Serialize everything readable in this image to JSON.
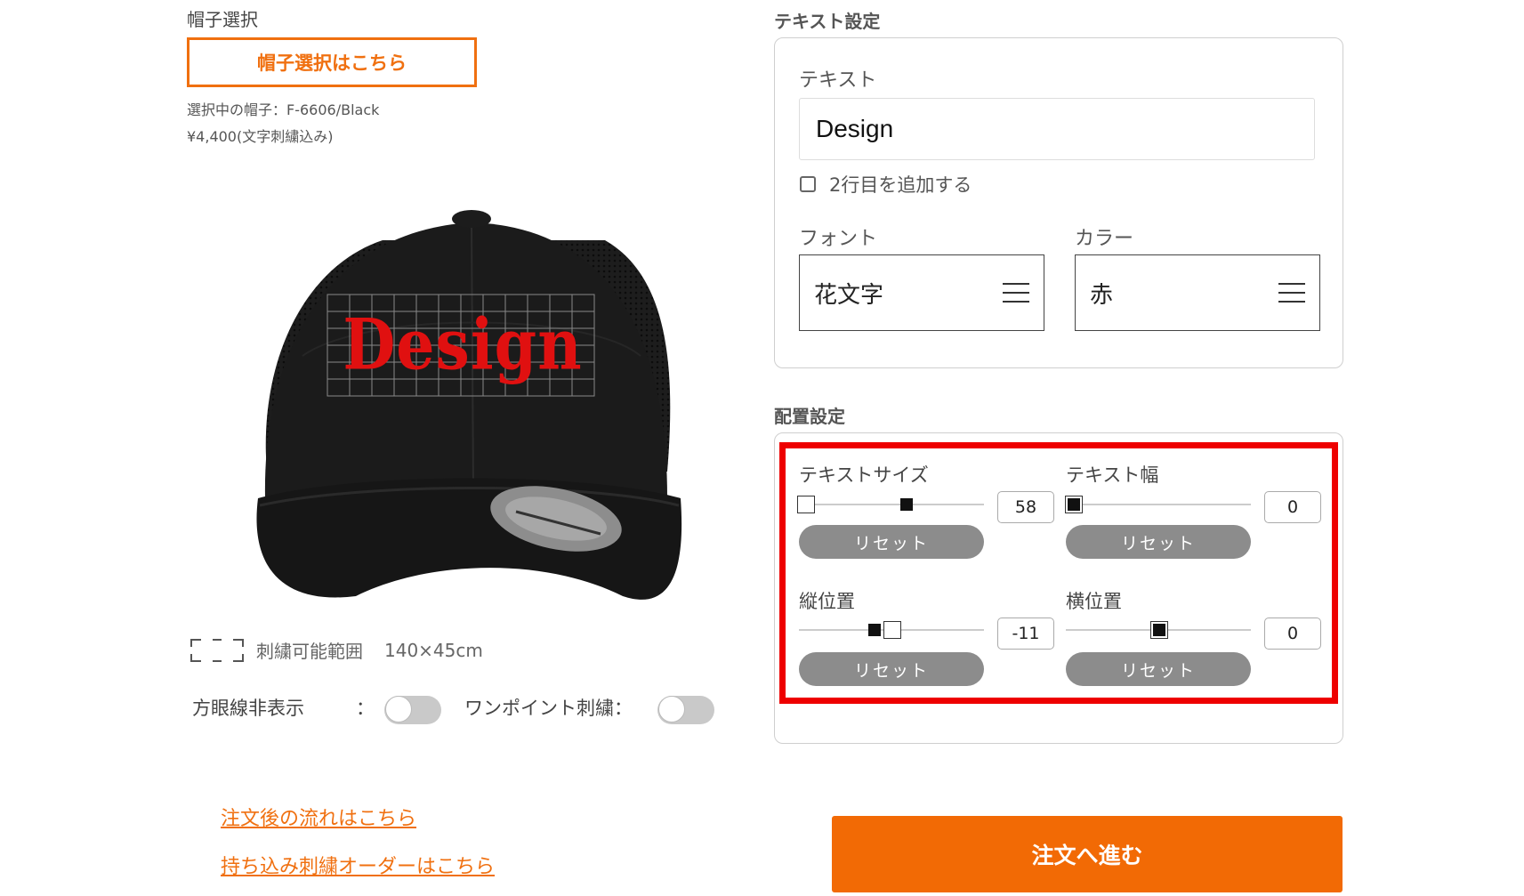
{
  "left": {
    "cap_section_label": "帽子選択",
    "cap_select_button": "帽子選択はこちら",
    "selected_cap": "選択中の帽子：F-6606/Black",
    "price": "¥4,400(文字刺繍込み)",
    "preview_text": "Design",
    "embroidery_range_label": "刺繍可能範囲",
    "embroidery_range_value": "140×45cm",
    "grid_hide_label": "方眼線非表示",
    "colon": "：",
    "onepoint_label": "ワンポイント刺繍：",
    "link_after_order": "注文後の流れはこちら",
    "link_bring_in": "持ち込み刺繍オーダーはこちら"
  },
  "text_settings": {
    "title": "テキスト設定",
    "text_label": "テキスト",
    "text_value": "Design",
    "add_line_label": "2行目を追加する",
    "font_label": "フォント",
    "font_value": "花文字",
    "color_label": "カラー",
    "color_value": "赤"
  },
  "layout_settings": {
    "title": "配置設定",
    "text_size_label": "テキストサイズ",
    "text_size_value": "58",
    "text_width_label": "テキスト幅",
    "text_width_value": "0",
    "vertical_label": "縦位置",
    "vertical_value": "-11",
    "horizontal_label": "横位置",
    "horizontal_value": "0",
    "reset_label": "リセット"
  },
  "order_button": "注文へ進む",
  "colors": {
    "accent": "#f26a05",
    "highlight": "#ee0000",
    "embroidery": "#e01010"
  }
}
